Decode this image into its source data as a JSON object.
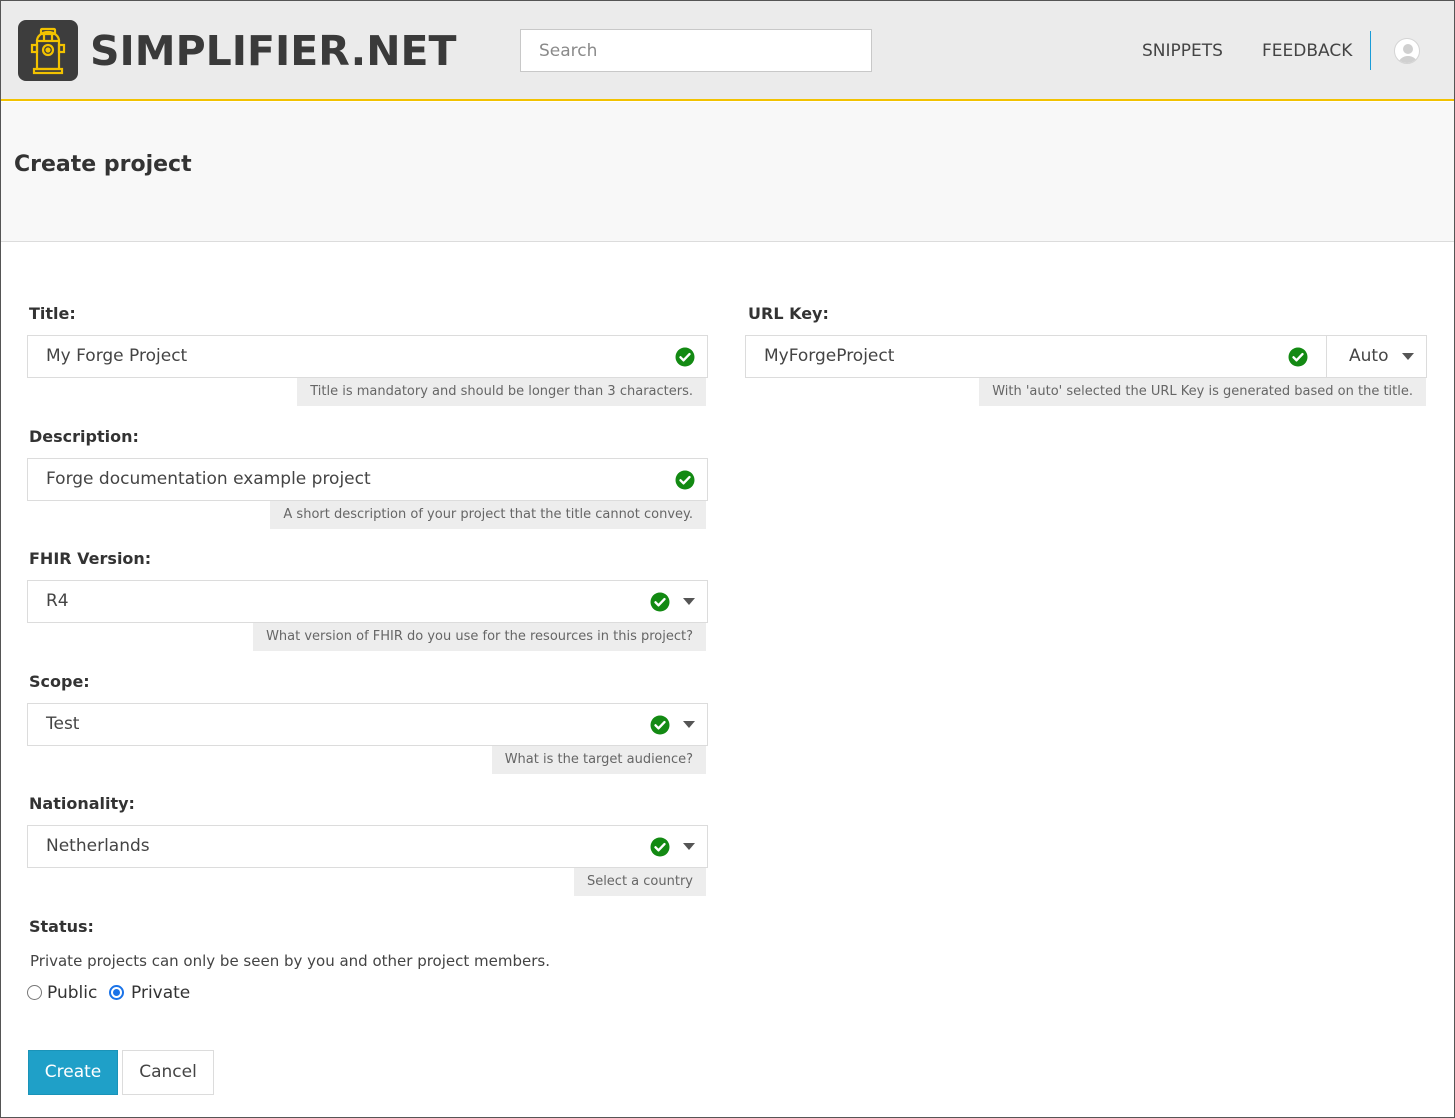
{
  "header": {
    "brand": "SIMPLIFIER.NET",
    "search_placeholder": "Search",
    "nav": {
      "snippets": "SNIPPETS",
      "feedback": "FEEDBACK"
    },
    "accent_color": "#f2c200",
    "divider_color": "#1a9bd7"
  },
  "page": {
    "title": "Create project"
  },
  "form": {
    "title": {
      "label": "Title:",
      "value": "My Forge Project",
      "hint": "Title is mandatory and should be longer than 3 characters."
    },
    "description": {
      "label": "Description:",
      "value": "Forge documentation example project",
      "hint": "A short description of your project that the title cannot convey."
    },
    "fhir_version": {
      "label": "FHIR Version:",
      "value": "R4",
      "hint": "What version of FHIR do you use for the resources in this project?"
    },
    "scope": {
      "label": "Scope:",
      "value": "Test",
      "hint": "What is the target audience?"
    },
    "nationality": {
      "label": "Nationality:",
      "value": "Netherlands",
      "hint": "Select a country"
    },
    "url_key": {
      "label": "URL Key:",
      "value": "MyForgeProject",
      "mode": "Auto",
      "hint": "With 'auto' selected the URL Key is generated based on the title."
    },
    "status": {
      "label": "Status:",
      "description": "Private projects can only be seen by you and other project members.",
      "options": [
        "Public",
        "Private"
      ],
      "selected": "Private"
    },
    "buttons": {
      "create": "Create",
      "cancel": "Cancel"
    },
    "valid_color": "#138a13",
    "primary_color": "#1fa0c8"
  }
}
